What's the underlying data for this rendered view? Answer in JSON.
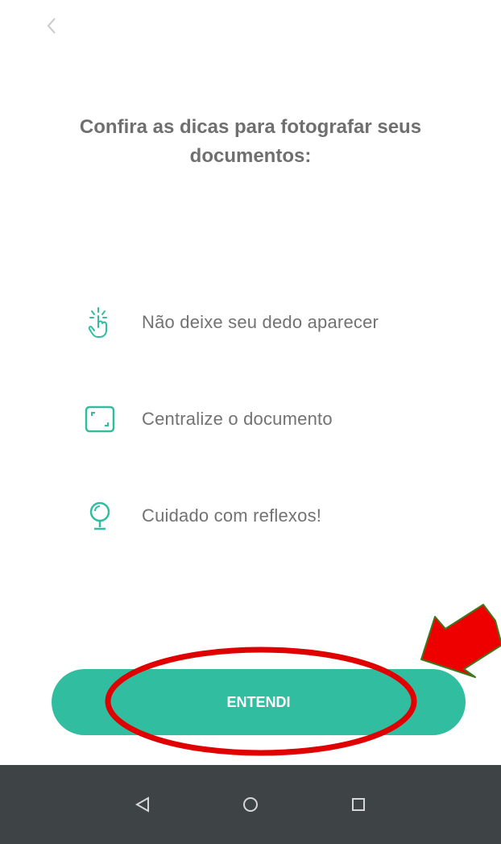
{
  "title": "Confira as dicas para fotografar seus documentos:",
  "tips": [
    {
      "label": "Não deixe seu dedo aparecer",
      "icon": "finger-touch-icon"
    },
    {
      "label": "Centralize o documento",
      "icon": "document-frame-icon"
    },
    {
      "label": "Cuidado com reflexos!",
      "icon": "reflection-mirror-icon"
    }
  ],
  "button": {
    "label": "ENTENDI"
  },
  "colors": {
    "accent": "#31bea0",
    "annotation": "#e00000",
    "arrow": "#ee0000",
    "arrow_outline": "#3a7a1a",
    "navbar": "#3e4345"
  }
}
